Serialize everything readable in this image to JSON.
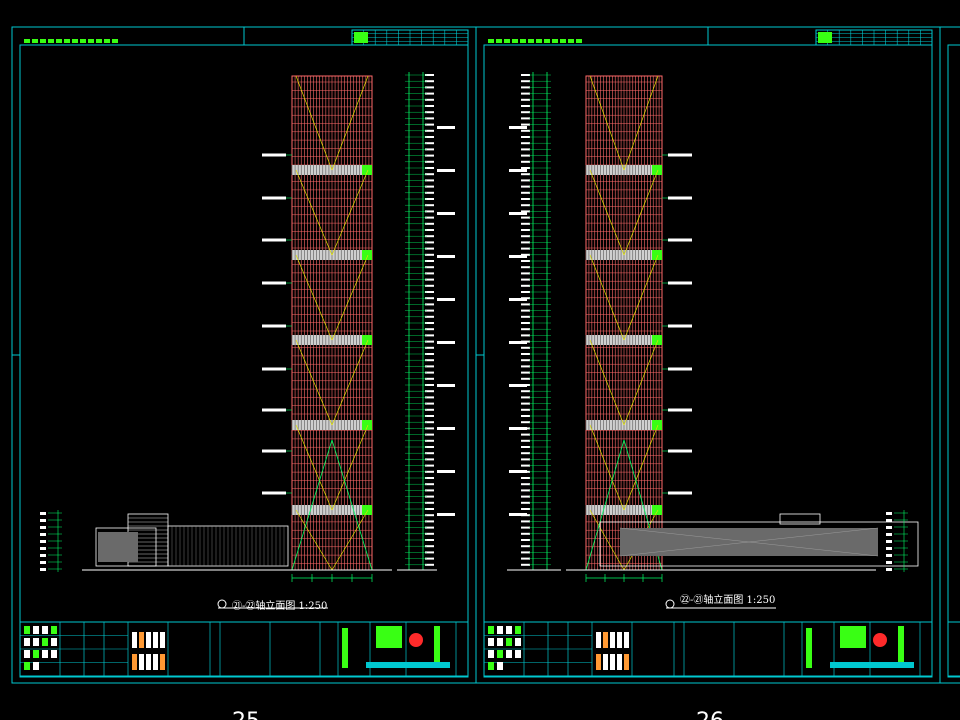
{
  "colors": {
    "background": "#000000",
    "frame": "#00c8d0",
    "facade": "#ff6a6a",
    "facade_band": "#d0d0d0",
    "accent_green": "#39ff14",
    "dimension": "#00ff66",
    "yellow": "#e0e000",
    "white": "#ffffff",
    "gray": "#9a9a9a",
    "logo_red": "#ff2a2a"
  },
  "sheets": [
    {
      "id": "sheet-25",
      "view_title": "㉑-㉒轴立面图 1:250",
      "page_number": "25",
      "mirrored": false
    },
    {
      "id": "sheet-26",
      "view_title": "㉒-㉑轴立面图 1:250",
      "page_number": "26",
      "mirrored": true
    }
  ]
}
